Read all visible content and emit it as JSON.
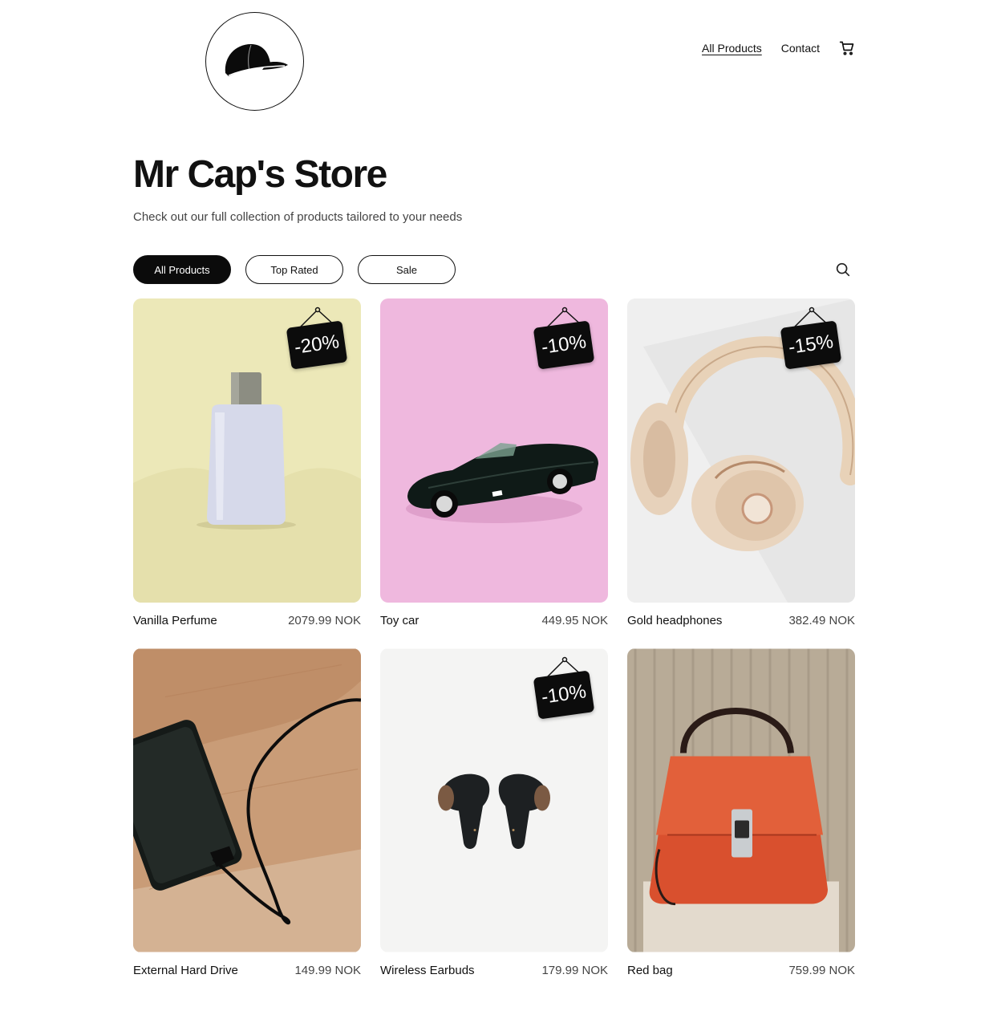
{
  "header": {
    "logo_icon": "cap-icon",
    "nav": [
      {
        "label": "All Products",
        "active": true
      },
      {
        "label": "Contact",
        "active": false
      }
    ],
    "cart_icon": "cart-icon"
  },
  "hero": {
    "title": "Mr Cap's Store",
    "subtitle": "Check out our full collection of products tailored to your needs"
  },
  "filters": {
    "tabs": [
      {
        "label": "All Products",
        "active": true
      },
      {
        "label": "Top Rated",
        "active": false
      },
      {
        "label": "Sale",
        "active": false
      }
    ],
    "search_icon": "search-icon"
  },
  "products": [
    {
      "name": "Vanilla Perfume",
      "price": "2079.99 NOK",
      "discount": "-20%",
      "bg": "#ece8b9"
    },
    {
      "name": "Toy car",
      "price": "449.95 NOK",
      "discount": "-10%",
      "bg": "#efb7dd"
    },
    {
      "name": "Gold headphones",
      "price": "382.49 NOK",
      "discount": "-15%",
      "bg": "#f0f0f0"
    },
    {
      "name": "External Hard Drive",
      "price": "149.99 NOK",
      "discount": "",
      "bg": "#c89b75"
    },
    {
      "name": "Wireless Earbuds",
      "price": "179.99 NOK",
      "discount": "-10%",
      "bg": "#f3f3f3"
    },
    {
      "name": "Red bag",
      "price": "759.99 NOK",
      "discount": "",
      "bg": "#b8ab96"
    }
  ]
}
